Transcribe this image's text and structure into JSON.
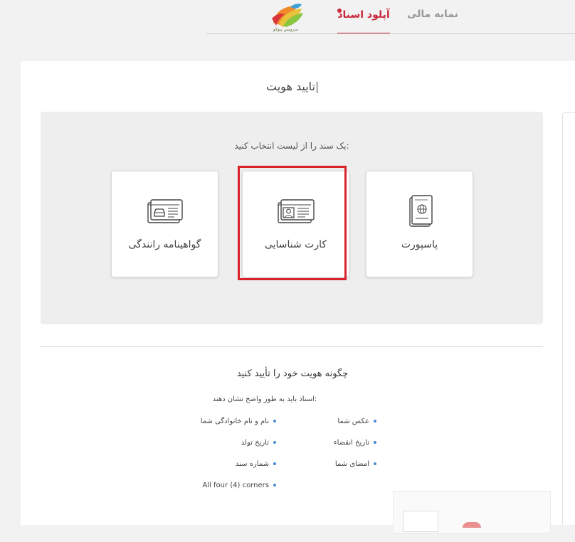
{
  "header": {
    "logo_text": "سرویس پیوکو",
    "tabs": [
      {
        "label": "آپلود اسناد",
        "active": true
      },
      {
        "label": "نمایه مالی"
      }
    ]
  },
  "page": {
    "title": "تایید هویت"
  },
  "selector": {
    "prompt": "یک سند را از لیست انتخاب کنید:",
    "cards": [
      {
        "label": "گواهینامه رانندگی",
        "icon": "drivers-license-icon"
      },
      {
        "label": "کارت شناسایی",
        "icon": "id-card-icon",
        "selected": true
      },
      {
        "label": "پاسپورت",
        "icon": "passport-icon"
      }
    ]
  },
  "instructions": {
    "title": "چگونه هویت خود را تأیید کنید",
    "subtitle": "اسناد باید به طور واضح نشان دهند:",
    "items": [
      "عکس شما",
      "نام و نام خانوادگی شما",
      "تاریخ انقضاء",
      "تاریخ تولد",
      "امضای شما",
      "شماره سند",
      "All four (4) corners"
    ]
  },
  "colors": {
    "accent": "#c8283a",
    "highlight": "#d9222a",
    "bullet": "#4a8ad8"
  }
}
